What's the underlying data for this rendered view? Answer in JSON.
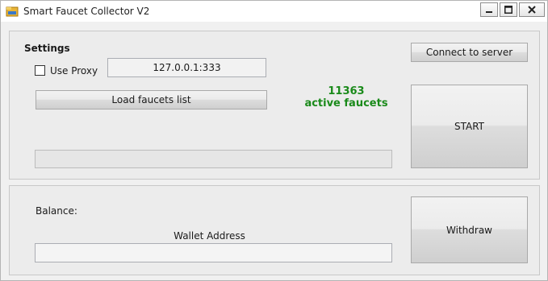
{
  "window": {
    "title": "Smart Faucet Collector V2",
    "app_icon": "folder-app-icon",
    "controls": {
      "minimize_icon": "minimize-icon",
      "maximize_icon": "maximize-icon",
      "close_icon": "close-icon"
    }
  },
  "settings": {
    "heading": "Settings",
    "use_proxy_label": "Use Proxy",
    "use_proxy_checked": false,
    "proxy_value": "127.0.0.1:333",
    "load_button": "Load faucets list",
    "connect_button": "Connect to server",
    "faucet_count": "11363",
    "faucet_count_label": "active faucets",
    "start_button": "START",
    "progress_percent": 0
  },
  "wallet": {
    "balance_label": "Balance:",
    "wallet_address_label": "Wallet Address",
    "wallet_address_value": "",
    "withdraw_button": "Withdraw"
  },
  "colors": {
    "count_text": "#1a8a1a",
    "title_bar": "#ffffff",
    "background": "#f0f0f0"
  }
}
